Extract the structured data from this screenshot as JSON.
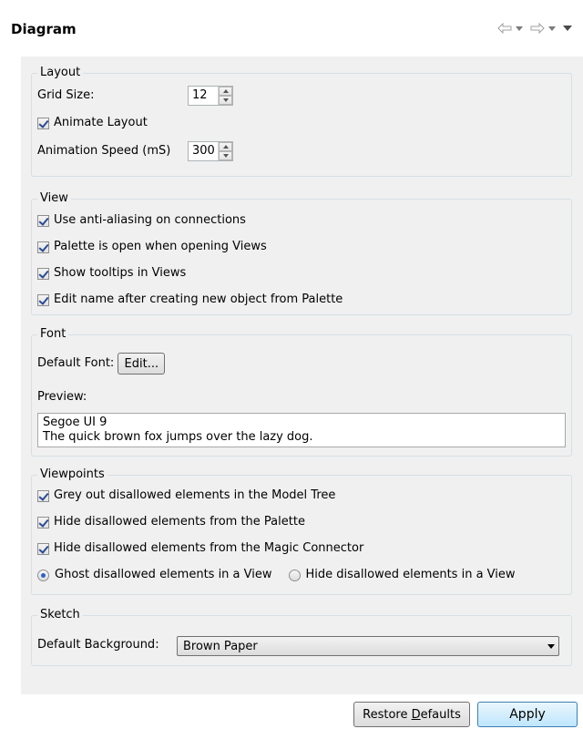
{
  "header": {
    "title": "Diagram",
    "icons": {
      "back": "back-arrow-icon",
      "forward": "forward-arrow-icon",
      "menu": "view-menu-icon"
    }
  },
  "layout": {
    "legend": "Layout",
    "grid_size_label": "Grid Size:",
    "grid_size_value": "12",
    "animate_layout_label": "Animate Layout",
    "animate_layout_checked": true,
    "animation_speed_label": "Animation Speed (mS)",
    "animation_speed_value": "300"
  },
  "view": {
    "legend": "View",
    "options": [
      {
        "label": "Use anti-aliasing on connections",
        "checked": true
      },
      {
        "label": "Palette is open when opening Views",
        "checked": true
      },
      {
        "label": "Show tooltips in Views",
        "checked": true
      },
      {
        "label": "Edit name after creating new object from Palette",
        "checked": true
      }
    ]
  },
  "font": {
    "legend": "Font",
    "default_font_label": "Default Font:",
    "edit_button": "Edit...",
    "preview_label": "Preview:",
    "preview_line1": "Segoe UI 9",
    "preview_line2": "The quick brown fox jumps over the lazy dog."
  },
  "viewpoints": {
    "legend": "Viewpoints",
    "options": [
      {
        "label": "Grey out disallowed elements in the Model Tree",
        "checked": true
      },
      {
        "label": "Hide disallowed elements from the Palette",
        "checked": true
      },
      {
        "label": "Hide disallowed elements from the Magic Connector",
        "checked": true
      }
    ],
    "radio_ghost": "Ghost disallowed elements in a View",
    "radio_hide": "Hide disallowed elements in a View",
    "selected_radio": "ghost"
  },
  "sketch": {
    "legend": "Sketch",
    "default_background_label": "Default Background:",
    "default_background_value": "Brown Paper"
  },
  "footer": {
    "restore_defaults_pre": "Restore ",
    "restore_defaults_mnemonic": "D",
    "restore_defaults_post": "efaults",
    "apply": "Apply"
  },
  "colors": {
    "panel_bg": "#f0f0f0",
    "group_border": "#d5dfe5",
    "check_mark": "#2a4b93",
    "primary_button": "#bee6fd"
  }
}
